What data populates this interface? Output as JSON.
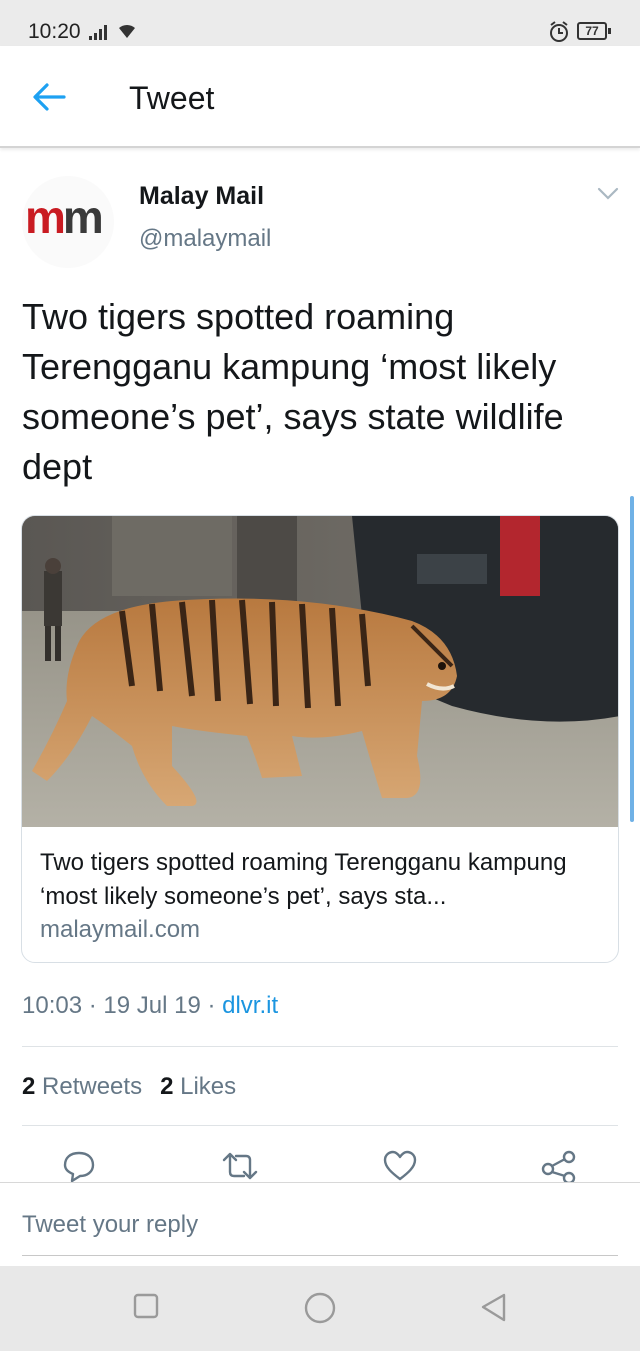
{
  "status_bar": {
    "time": "10:20",
    "battery": "77"
  },
  "header": {
    "title": "Tweet"
  },
  "tweet": {
    "author_name": "Malay Mail",
    "author_handle": "@malaymail",
    "avatar_text_1": "m",
    "avatar_text_2": "m",
    "text": "Two tigers spotted roaming Terengganu kampung ‘most likely someone’s pet’, says state wildlife dept",
    "card": {
      "title": "Two tigers spotted roaming Terengganu kampung ‘most likely someone’s pet’, says sta...",
      "domain": "malaymail.com"
    },
    "time": "10:03",
    "date": "19 Jul 19",
    "source": "dlvr.it",
    "separator": " · ",
    "retweets_count": "2",
    "retweets_label": "Retweets",
    "likes_count": "2",
    "likes_label": "Likes"
  },
  "reply": {
    "placeholder": "Tweet your reply"
  },
  "icons": {
    "back": "arrow-left-icon",
    "more": "chevron-down-icon",
    "reply": "comment-icon",
    "retweet": "retweet-icon",
    "like": "heart-icon",
    "share": "share-icon"
  },
  "colors": {
    "accent": "#1da1f2",
    "link": "#1b95e0",
    "secondary_text": "#657786",
    "brand_red": "#c91b22"
  }
}
